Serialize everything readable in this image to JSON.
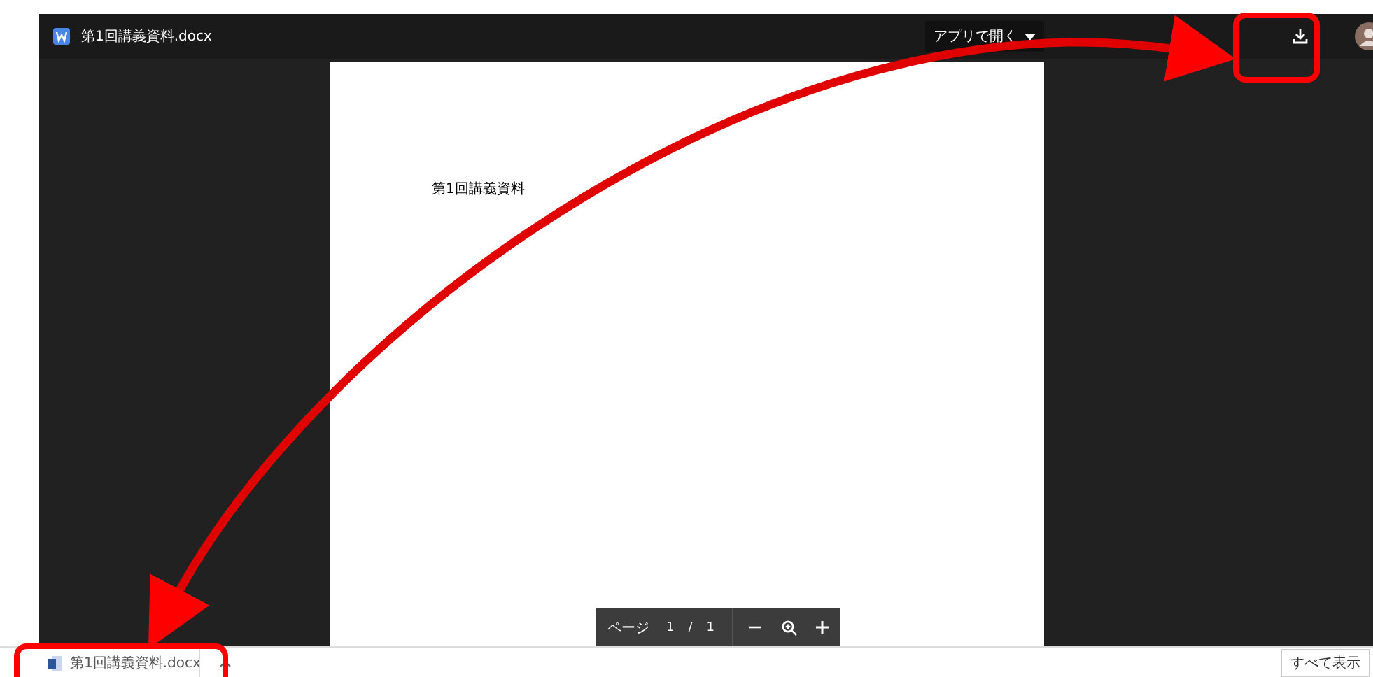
{
  "viewer": {
    "file_name": "第1回講義資料.docx",
    "open_with": "アプリで開く"
  },
  "document": {
    "text": "第1回講義資料"
  },
  "page_toolbar": {
    "page_label": "ページ",
    "current": "1",
    "separator": "/",
    "total": "1"
  },
  "download_bar": {
    "file_name": "第1回講義資料.docx",
    "show_all": "すべて表示"
  }
}
